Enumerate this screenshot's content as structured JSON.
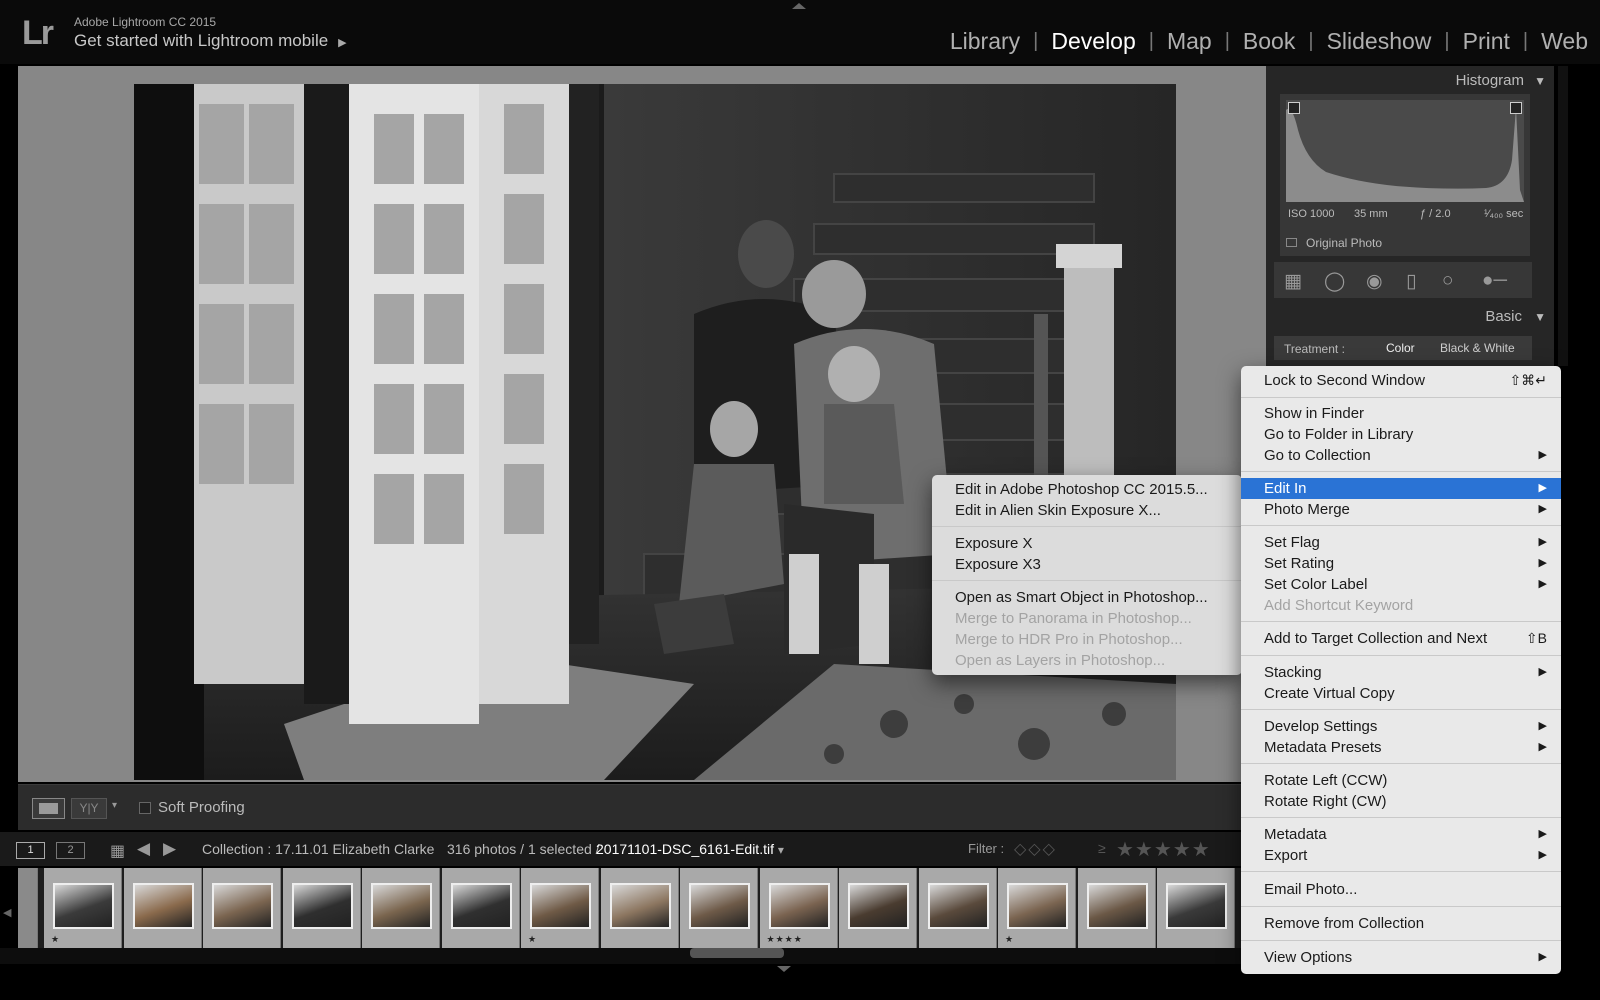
{
  "app": {
    "logo": "Lr",
    "title": "Adobe Lightroom CC 2015",
    "mobile_link": "Get started with Lightroom mobile",
    "mobile_arrow": "▶"
  },
  "modules": {
    "items": [
      "Library",
      "Develop",
      "Map",
      "Book",
      "Slideshow",
      "Print",
      "Web"
    ],
    "active": "Develop",
    "separator": "|"
  },
  "toolbar": {
    "soft_proofing": "Soft Proofing",
    "compare_label": "Y|Y"
  },
  "filmstrip_header": {
    "screen1": "1",
    "screen2": "2",
    "collection": "Collection : 17.11.01 Elizabeth Clarke",
    "count": "316 photos / 1 selected /",
    "filename": "20171101-DSC_6161-Edit.tif",
    "filename_arrow": "▾",
    "filter_label": "Filter :",
    "rating_op": "≥",
    "stars": "★★★★★"
  },
  "filmstrip": {
    "thumbs": [
      {
        "stars": "★",
        "tone": "#3b3b3b"
      },
      {
        "stars": "",
        "tone": "#8a6a4c"
      },
      {
        "stars": "",
        "tone": "#7b6550"
      },
      {
        "stars": "",
        "tone": "#2f2f2f"
      },
      {
        "stars": "",
        "tone": "#7a654e"
      },
      {
        "stars": "",
        "tone": "#303030"
      },
      {
        "stars": "★",
        "tone": "#6f5a46"
      },
      {
        "stars": "",
        "tone": "#8c7660"
      },
      {
        "stars": "",
        "tone": "#6e5a48"
      },
      {
        "stars": "★★★★",
        "tone": "#7a6350"
      },
      {
        "stars": "",
        "tone": "#4a3c30"
      },
      {
        "stars": "",
        "tone": "#5a4a3c"
      },
      {
        "stars": "★",
        "tone": "#7b6551"
      },
      {
        "stars": "",
        "tone": "#6b5846"
      },
      {
        "stars": "",
        "tone": "#3a3a3a"
      }
    ]
  },
  "histogram": {
    "title": "Histogram",
    "iso": "ISO 1000",
    "focal": "35 mm",
    "aperture": "ƒ / 2.0",
    "shutter": "¹⁄₄₀₀ sec",
    "original_photo": "Original Photo"
  },
  "basic": {
    "title": "Basic",
    "treatment_label": "Treatment :",
    "color": "Color",
    "bw": "Black & White"
  },
  "context_menu": {
    "lock": "Lock to Second Window",
    "lock_shortcut": "⇧⌘↵",
    "show_finder": "Show in Finder",
    "goto_folder": "Go to Folder in Library",
    "goto_collection": "Go to Collection",
    "edit_in": "Edit In",
    "photo_merge": "Photo Merge",
    "set_flag": "Set Flag",
    "set_rating": "Set Rating",
    "set_color": "Set Color Label",
    "add_keyword": "Add Shortcut Keyword",
    "add_target": "Add to Target Collection and Next",
    "add_target_shortcut": "⇧B",
    "stacking": "Stacking",
    "virtual_copy": "Create Virtual Copy",
    "develop_settings": "Develop Settings",
    "metadata_presets": "Metadata Presets",
    "rotate_left": "Rotate Left (CCW)",
    "rotate_right": "Rotate Right (CW)",
    "metadata": "Metadata",
    "export": "Export",
    "email": "Email Photo...",
    "remove": "Remove from Collection",
    "view_options": "View Options",
    "arrow": "▶"
  },
  "submenu": {
    "photoshop": "Edit in Adobe Photoshop CC 2015.5...",
    "alienskin": "Edit in Alien Skin Exposure X...",
    "exposure_x": "Exposure X",
    "exposure_x3": "Exposure X3",
    "smart_object": "Open as Smart Object in Photoshop...",
    "panorama": "Merge to Panorama in Photoshop...",
    "hdr": "Merge to HDR Pro in Photoshop...",
    "layers": "Open as Layers in Photoshop..."
  },
  "colors": {
    "highlight": "#2a73d5",
    "menu_bg": "#e9e9e9",
    "canvas_bg": "#878787"
  }
}
